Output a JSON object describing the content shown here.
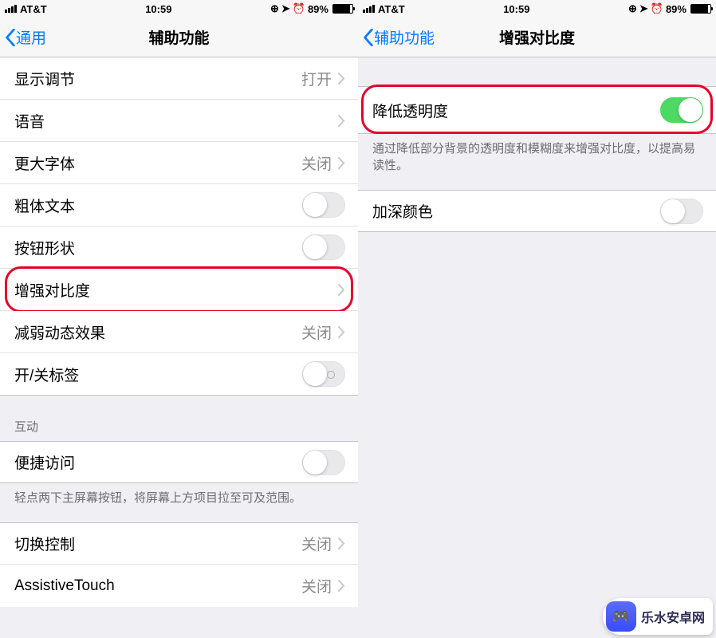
{
  "status": {
    "carrier": "AT&T",
    "time": "10:59",
    "battery_pct": "89%"
  },
  "left": {
    "back": "通用",
    "title": "辅助功能",
    "rows": {
      "display": {
        "label": "显示调节",
        "value": "打开"
      },
      "speech": {
        "label": "语音"
      },
      "largerText": {
        "label": "更大字体",
        "value": "关闭"
      },
      "boldText": {
        "label": "粗体文本"
      },
      "buttonShapes": {
        "label": "按钮形状"
      },
      "increaseContrast": {
        "label": "增强对比度"
      },
      "reduceMotion": {
        "label": "减弱动态效果",
        "value": "关闭"
      },
      "onOffLabels": {
        "label": "开/关标签"
      },
      "reachability": {
        "label": "便捷访问"
      },
      "switchControl": {
        "label": "切换控制",
        "value": "关闭"
      },
      "assistiveTouch": {
        "label": "AssistiveTouch",
        "value": "关闭"
      }
    },
    "sectionInteraction": "互动",
    "reachabilityNote": "轻点两下主屏幕按钮，将屏幕上方项目拉至可及范围。"
  },
  "right": {
    "back": "辅助功能",
    "title": "增强对比度",
    "rows": {
      "reduceTransparency": {
        "label": "降低透明度"
      },
      "darkenColors": {
        "label": "加深颜色"
      }
    },
    "transparencyNote": "通过降低部分背景的透明度和模糊度来增强对比度，以提高易读性。"
  },
  "watermark": "乐水安卓网"
}
